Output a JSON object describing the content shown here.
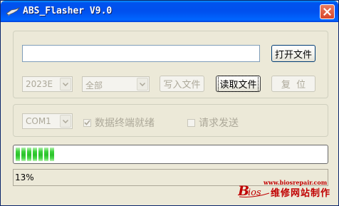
{
  "window": {
    "title": "ABS_Flasher V9.0"
  },
  "file": {
    "path_value": "",
    "open_label": "打开文件"
  },
  "options": {
    "chip_selected": "2023E",
    "region_selected": "全部",
    "write_label": "写入文件",
    "read_label": "读取文件",
    "reset_label": "复  位"
  },
  "connection": {
    "port_selected": "COM1",
    "ready_label": "数据终端就绪",
    "ready_checked": true,
    "request_label": "请求发送",
    "request_checked": false
  },
  "progress": {
    "fraction": 0.13,
    "status_text": "13%"
  },
  "watermark": {
    "url": "www.biosrepair.com",
    "logo_text": "Bios",
    "cn_text": "维修网站制作"
  },
  "colors": {
    "title_bar": "#0054e3",
    "progress_fill": "#2bc02b",
    "watermark": "#c00000",
    "window_bg": "#ece9d8"
  }
}
